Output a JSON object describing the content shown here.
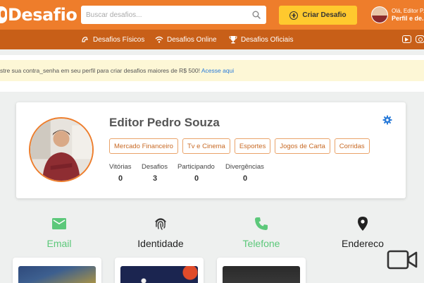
{
  "header": {
    "logo_text": "Desafio",
    "search_placeholder": "Buscar desafios...",
    "create_label": "Criar Desafio",
    "user_greeting": "Olá, Editor P...",
    "user_link": "Perfil e de..."
  },
  "subnav": {
    "partial_label": "u",
    "items": [
      {
        "label": "Desafios Físicos",
        "icon": "dumbbell-icon"
      },
      {
        "label": "Desafios Online",
        "icon": "wifi-icon"
      },
      {
        "label": "Desafios Oficiais",
        "icon": "trophy-icon"
      }
    ],
    "social": [
      "youtube-icon",
      "instagram-icon"
    ]
  },
  "alert": {
    "text": "stre sua contra_senha em seu perfil para criar desafios maiores de R$ 500! ",
    "link": "Acesse aqui"
  },
  "profile": {
    "name": "Editor Pedro Souza",
    "tags": [
      "Mercado Financeiro",
      "Tv e Cinema",
      "Esportes",
      "Jogos de Carta",
      "Corridas"
    ],
    "stats": [
      {
        "label": "Vitórias",
        "value": "0"
      },
      {
        "label": "Desafios",
        "value": "3"
      },
      {
        "label": "Participando",
        "value": "0"
      },
      {
        "label": "Divergências",
        "value": "0"
      }
    ]
  },
  "verifications": [
    {
      "label": "Email",
      "icon": "mail-icon",
      "verified": true
    },
    {
      "label": "Identidade",
      "icon": "fingerprint-icon",
      "verified": false
    },
    {
      "label": "Telefone",
      "icon": "phone-icon",
      "verified": true
    },
    {
      "label": "Endereco",
      "icon": "location-pin-icon",
      "verified": false
    }
  ],
  "colors": {
    "brand_orange": "#ee7d2b",
    "nav_orange": "#c85f18",
    "create_button": "#ffc92e",
    "verified_green": "#5cc87a",
    "alert_link": "#2a7bd9"
  }
}
